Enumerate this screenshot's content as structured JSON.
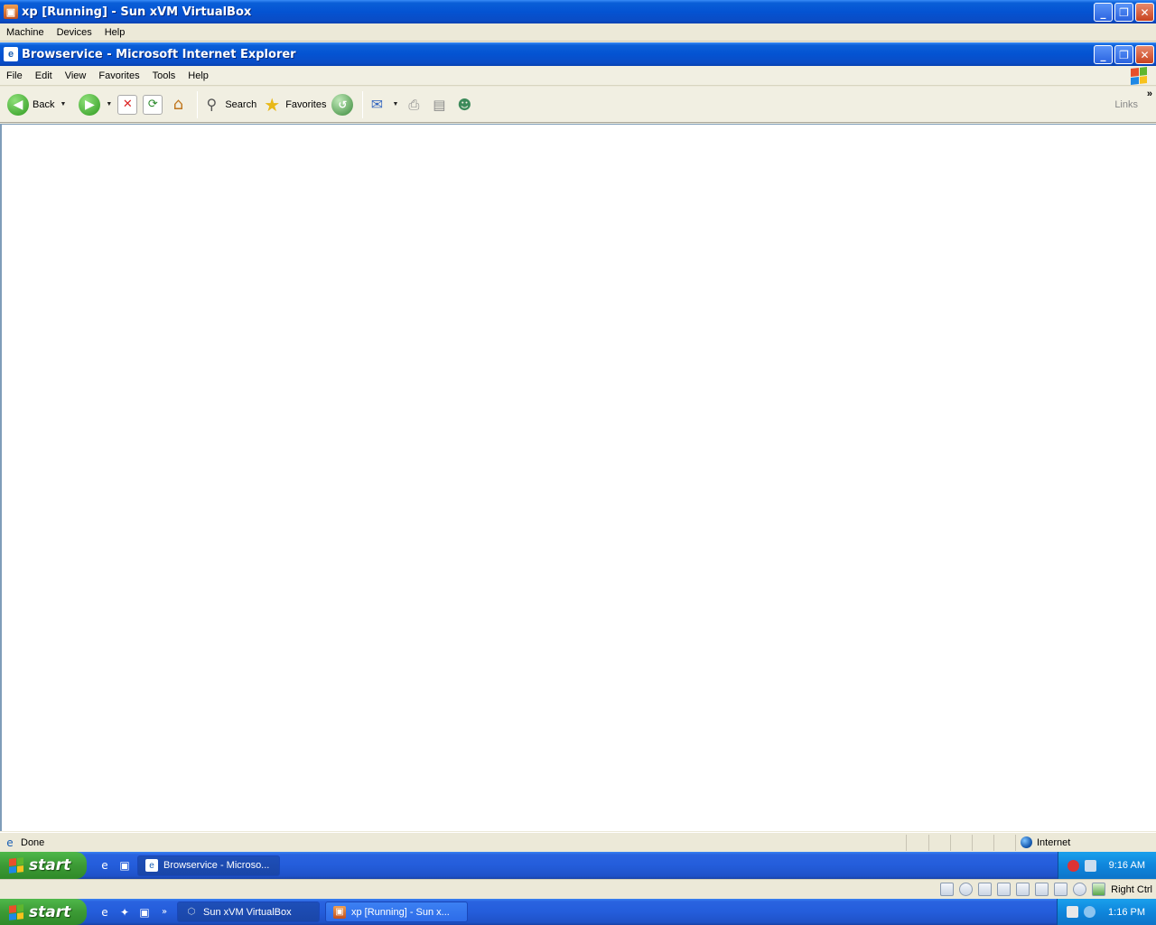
{
  "vbox": {
    "title": "xp [Running] - Sun xVM VirtualBox",
    "menu": [
      "Machine",
      "Devices",
      "Help"
    ],
    "host_key": "Right Ctrl"
  },
  "ie": {
    "title": "Browservice - Microsoft Internet Explorer",
    "menu": [
      "File",
      "Edit",
      "View",
      "Favorites",
      "Tools",
      "Help"
    ],
    "toolbar": {
      "back": "Back",
      "search": "Search",
      "favorites": "Favorites",
      "links": "Links"
    },
    "status": {
      "text": "Done",
      "zone": "Internet"
    }
  },
  "guest_taskbar": {
    "start": "start",
    "tasks": [
      {
        "label": "Browservice - Microso..."
      }
    ],
    "clock": "9:16 AM"
  },
  "host_taskbar": {
    "start": "start",
    "tasks": [
      {
        "label": "Sun xVM VirtualBox"
      },
      {
        "label": "xp [Running] - Sun x..."
      }
    ],
    "clock": "1:16 PM"
  },
  "colors": {
    "xp_title_blue": "#0453d2",
    "start_green": "#3c9a35",
    "tray_blue": "#0f86dc"
  }
}
